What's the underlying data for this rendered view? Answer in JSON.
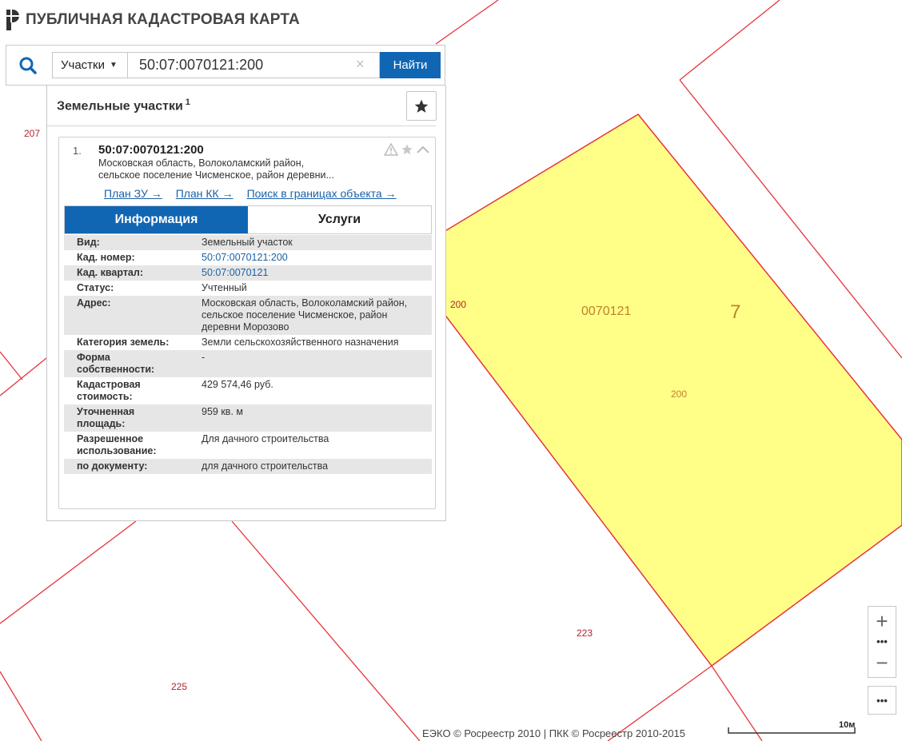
{
  "app": {
    "title": "ПУБЛИЧНАЯ КАДАСТРОВАЯ КАРТА"
  },
  "search": {
    "type_selected": "Участки",
    "query": "50:07:0070121:200",
    "clear": "×",
    "submit": "Найти"
  },
  "results": {
    "title": "Земельные участки",
    "count": "1",
    "items": [
      {
        "index": "1.",
        "cadastral_number": "50:07:0070121:200",
        "address_line1": "Московская область, Волоколамский район,",
        "address_line2": "сельское поселение Чисменское, район деревни...",
        "links": [
          "План ЗУ →",
          "План КК →",
          "Поиск в границах объекта →"
        ],
        "tabs": [
          "Информация",
          "Услуги"
        ],
        "info": [
          {
            "key": "Вид:",
            "value": "Земельный участок",
            "link": false
          },
          {
            "key": "Кад. номер:",
            "value": "50:07:0070121:200",
            "link": true
          },
          {
            "key": "Кад. квартал:",
            "value": "50:07:0070121",
            "link": true
          },
          {
            "key": "Статус:",
            "value": "Учтенный",
            "link": false
          },
          {
            "key": "Адрес:",
            "value": "Московская область, Волоколамский район, сельское поселение Чисменское, район деревни Морозово",
            "link": false
          },
          {
            "key": "Категория земель:",
            "value": "Земли сельскохозяйственного назначения",
            "link": false
          },
          {
            "key": "Форма собственности:",
            "value": "-",
            "link": false
          },
          {
            "key": "Кадастровая стоимость:",
            "value": "429 574,46 руб.",
            "link": false
          },
          {
            "key": "Уточненная площадь:",
            "value": "959 кв. м",
            "link": false
          },
          {
            "key": "Разрешенное использование:",
            "value": "Для дачного строительства",
            "link": false
          },
          {
            "key": "по документу:",
            "value": "для дачного строительства",
            "link": false
          }
        ]
      }
    ]
  },
  "map": {
    "labels": {
      "l207": "207",
      "l200a": "200",
      "l0070121": "0070121",
      "l7": "7",
      "l200b": "200",
      "l223": "223",
      "l225": "225"
    },
    "colors": {
      "parcel_fill": "#ffff88",
      "boundary": "#e6343c",
      "accent": "#1166b3"
    }
  },
  "controls": {
    "zoom_in": "+",
    "zoom_out": "−",
    "dots": "•••"
  },
  "footer": {
    "attribution": "ЕЭКО © Росреестр 2010 | ПКК © Росреестр 2010-2015",
    "scale": "10м"
  }
}
